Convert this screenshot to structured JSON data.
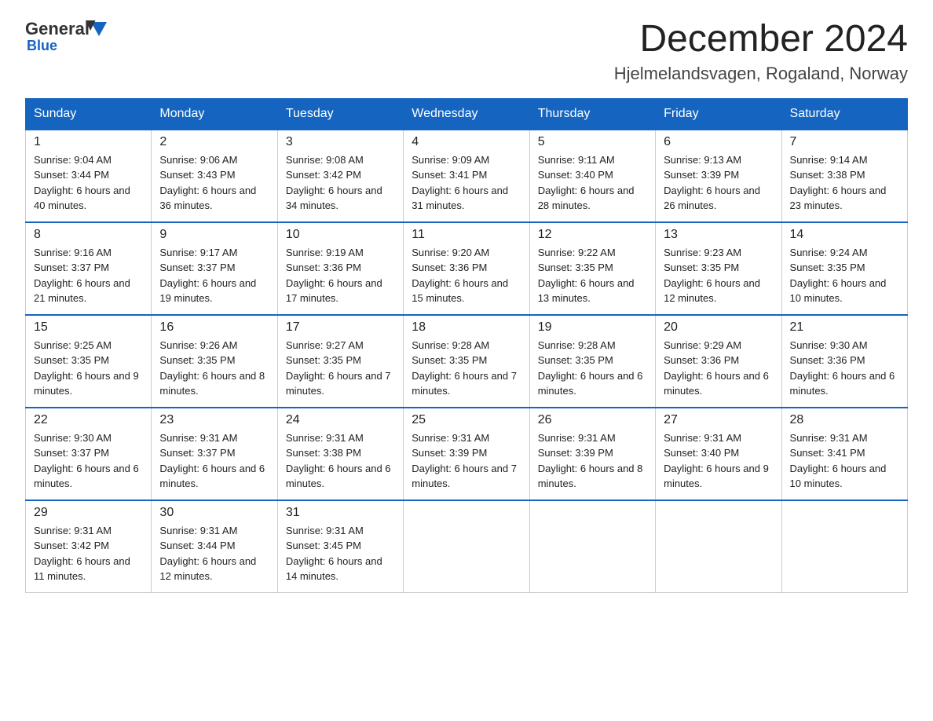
{
  "header": {
    "logo": {
      "general": "General",
      "triangle": "",
      "blue": "Blue"
    },
    "title": "December 2024",
    "subtitle": "Hjelmelandsvagen, Rogaland, Norway"
  },
  "days_of_week": [
    "Sunday",
    "Monday",
    "Tuesday",
    "Wednesday",
    "Thursday",
    "Friday",
    "Saturday"
  ],
  "weeks": [
    [
      {
        "day": "1",
        "sunrise": "9:04 AM",
        "sunset": "3:44 PM",
        "daylight": "6 hours and 40 minutes."
      },
      {
        "day": "2",
        "sunrise": "9:06 AM",
        "sunset": "3:43 PM",
        "daylight": "6 hours and 36 minutes."
      },
      {
        "day": "3",
        "sunrise": "9:08 AM",
        "sunset": "3:42 PM",
        "daylight": "6 hours and 34 minutes."
      },
      {
        "day": "4",
        "sunrise": "9:09 AM",
        "sunset": "3:41 PM",
        "daylight": "6 hours and 31 minutes."
      },
      {
        "day": "5",
        "sunrise": "9:11 AM",
        "sunset": "3:40 PM",
        "daylight": "6 hours and 28 minutes."
      },
      {
        "day": "6",
        "sunrise": "9:13 AM",
        "sunset": "3:39 PM",
        "daylight": "6 hours and 26 minutes."
      },
      {
        "day": "7",
        "sunrise": "9:14 AM",
        "sunset": "3:38 PM",
        "daylight": "6 hours and 23 minutes."
      }
    ],
    [
      {
        "day": "8",
        "sunrise": "9:16 AM",
        "sunset": "3:37 PM",
        "daylight": "6 hours and 21 minutes."
      },
      {
        "day": "9",
        "sunrise": "9:17 AM",
        "sunset": "3:37 PM",
        "daylight": "6 hours and 19 minutes."
      },
      {
        "day": "10",
        "sunrise": "9:19 AM",
        "sunset": "3:36 PM",
        "daylight": "6 hours and 17 minutes."
      },
      {
        "day": "11",
        "sunrise": "9:20 AM",
        "sunset": "3:36 PM",
        "daylight": "6 hours and 15 minutes."
      },
      {
        "day": "12",
        "sunrise": "9:22 AM",
        "sunset": "3:35 PM",
        "daylight": "6 hours and 13 minutes."
      },
      {
        "day": "13",
        "sunrise": "9:23 AM",
        "sunset": "3:35 PM",
        "daylight": "6 hours and 12 minutes."
      },
      {
        "day": "14",
        "sunrise": "9:24 AM",
        "sunset": "3:35 PM",
        "daylight": "6 hours and 10 minutes."
      }
    ],
    [
      {
        "day": "15",
        "sunrise": "9:25 AM",
        "sunset": "3:35 PM",
        "daylight": "6 hours and 9 minutes."
      },
      {
        "day": "16",
        "sunrise": "9:26 AM",
        "sunset": "3:35 PM",
        "daylight": "6 hours and 8 minutes."
      },
      {
        "day": "17",
        "sunrise": "9:27 AM",
        "sunset": "3:35 PM",
        "daylight": "6 hours and 7 minutes."
      },
      {
        "day": "18",
        "sunrise": "9:28 AM",
        "sunset": "3:35 PM",
        "daylight": "6 hours and 7 minutes."
      },
      {
        "day": "19",
        "sunrise": "9:28 AM",
        "sunset": "3:35 PM",
        "daylight": "6 hours and 6 minutes."
      },
      {
        "day": "20",
        "sunrise": "9:29 AM",
        "sunset": "3:36 PM",
        "daylight": "6 hours and 6 minutes."
      },
      {
        "day": "21",
        "sunrise": "9:30 AM",
        "sunset": "3:36 PM",
        "daylight": "6 hours and 6 minutes."
      }
    ],
    [
      {
        "day": "22",
        "sunrise": "9:30 AM",
        "sunset": "3:37 PM",
        "daylight": "6 hours and 6 minutes."
      },
      {
        "day": "23",
        "sunrise": "9:31 AM",
        "sunset": "3:37 PM",
        "daylight": "6 hours and 6 minutes."
      },
      {
        "day": "24",
        "sunrise": "9:31 AM",
        "sunset": "3:38 PM",
        "daylight": "6 hours and 6 minutes."
      },
      {
        "day": "25",
        "sunrise": "9:31 AM",
        "sunset": "3:39 PM",
        "daylight": "6 hours and 7 minutes."
      },
      {
        "day": "26",
        "sunrise": "9:31 AM",
        "sunset": "3:39 PM",
        "daylight": "6 hours and 8 minutes."
      },
      {
        "day": "27",
        "sunrise": "9:31 AM",
        "sunset": "3:40 PM",
        "daylight": "6 hours and 9 minutes."
      },
      {
        "day": "28",
        "sunrise": "9:31 AM",
        "sunset": "3:41 PM",
        "daylight": "6 hours and 10 minutes."
      }
    ],
    [
      {
        "day": "29",
        "sunrise": "9:31 AM",
        "sunset": "3:42 PM",
        "daylight": "6 hours and 11 minutes."
      },
      {
        "day": "30",
        "sunrise": "9:31 AM",
        "sunset": "3:44 PM",
        "daylight": "6 hours and 12 minutes."
      },
      {
        "day": "31",
        "sunrise": "9:31 AM",
        "sunset": "3:45 PM",
        "daylight": "6 hours and 14 minutes."
      },
      null,
      null,
      null,
      null
    ]
  ],
  "labels": {
    "sunrise_prefix": "Sunrise: ",
    "sunset_prefix": "Sunset: ",
    "daylight_prefix": "Daylight: "
  }
}
